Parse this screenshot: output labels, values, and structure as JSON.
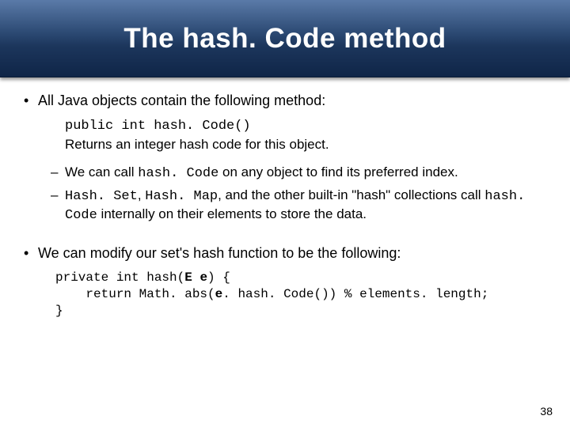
{
  "title": "The hash. Code method",
  "bullet1": {
    "text": "All Java objects contain the following method:",
    "signature": "public int hash. Code()",
    "desc": "Returns an integer hash code for this object.",
    "sub1_pre": "We can call ",
    "sub1_mono": "hash. Code",
    "sub1_post": " on any object to find its preferred index.",
    "sub2_mono1": "Hash. Set",
    "sub2_sep": ", ",
    "sub2_mono2": "Hash. Map",
    "sub2_mid": ", and the other built-in \"hash\" collections call ",
    "sub2_mono3": "hash. Code",
    "sub2_post": " internally on their elements to store the data."
  },
  "bullet2": {
    "text": "We can modify our set's hash function to be the following:",
    "code_l1_pre": "private int hash(",
    "code_l1_bold": "E e",
    "code_l1_post": ") {",
    "code_l2_pre": "    return Math. abs(",
    "code_l2_bold": "e",
    "code_l2_post": ". hash. Code()) % elements. length;",
    "code_l3": "}"
  },
  "page_number": "38"
}
